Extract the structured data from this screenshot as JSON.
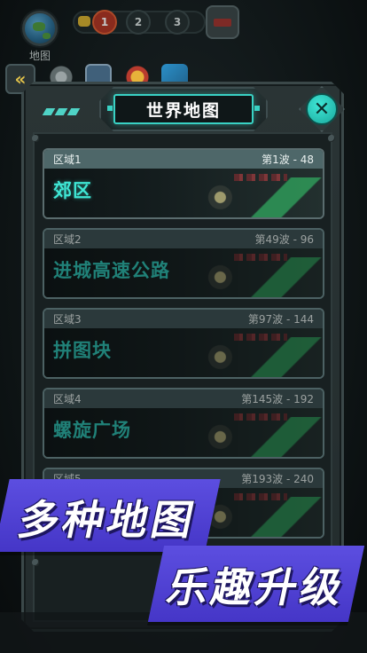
{
  "hud": {
    "map_label": "地图",
    "waves": [
      "1",
      "2",
      "3"
    ]
  },
  "modal": {
    "title": "世界地图"
  },
  "regions": [
    {
      "zone": "区域1",
      "waves": "第1波 - 48",
      "name": "郊区",
      "selected": true
    },
    {
      "zone": "区域2",
      "waves": "第49波 - 96",
      "name": "进城高速公路",
      "selected": false
    },
    {
      "zone": "区域3",
      "waves": "第97波 - 144",
      "name": "拼图块",
      "selected": false
    },
    {
      "zone": "区域4",
      "waves": "第145波 - 192",
      "name": "螺旋广场",
      "selected": false
    },
    {
      "zone": "区域5",
      "waves": "第193波 - 240",
      "name": "",
      "selected": false
    }
  ],
  "promo": {
    "line1": "多种地图",
    "line2": "乐趣升级"
  },
  "colors": {
    "accent": "#39d2c4",
    "banner": "#4e40d4",
    "active_wave": "#b3321f"
  }
}
